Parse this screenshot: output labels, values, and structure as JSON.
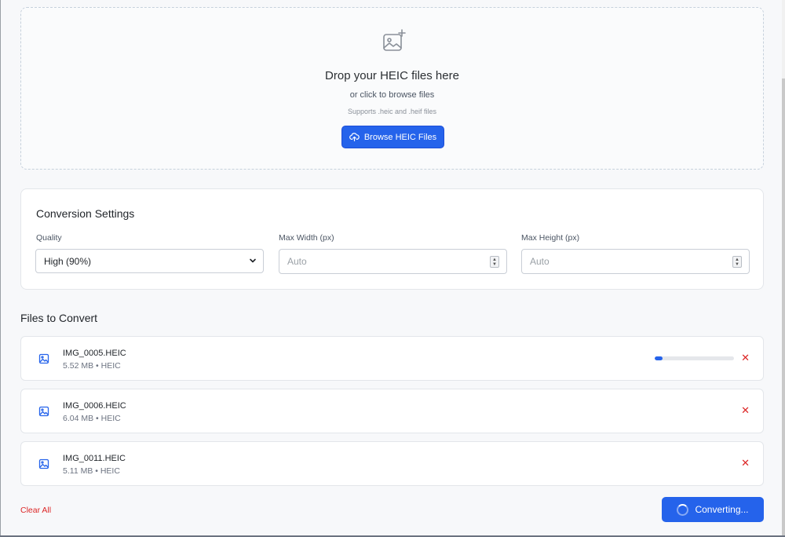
{
  "dropzone": {
    "title": "Drop your HEIC files here",
    "subtitle": "or click to browse files",
    "hint": "Supports .heic and .heif files",
    "browse_label": "Browse HEIC Files",
    "icon": "image-plus-icon"
  },
  "settings": {
    "title": "Conversion Settings",
    "quality_label": "Quality",
    "quality_value": "High (90%)",
    "max_width_label": "Max Width (px)",
    "max_width_placeholder": "Auto",
    "max_height_label": "Max Height (px)",
    "max_height_placeholder": "Auto"
  },
  "files": {
    "title": "Files to Convert",
    "items": [
      {
        "name": "IMG_0005.HEIC",
        "meta": "5.52 MB • HEIC",
        "progress": 0.1
      },
      {
        "name": "IMG_0006.HEIC",
        "meta": "6.04 MB • HEIC"
      },
      {
        "name": "IMG_0011.HEIC",
        "meta": "5.11 MB • HEIC"
      }
    ],
    "remove_glyph": "✕"
  },
  "footer": {
    "clear_all_label": "Clear All",
    "convert_label": "Converting..."
  },
  "colors": {
    "accent": "#2563eb",
    "danger": "#dc2626"
  }
}
